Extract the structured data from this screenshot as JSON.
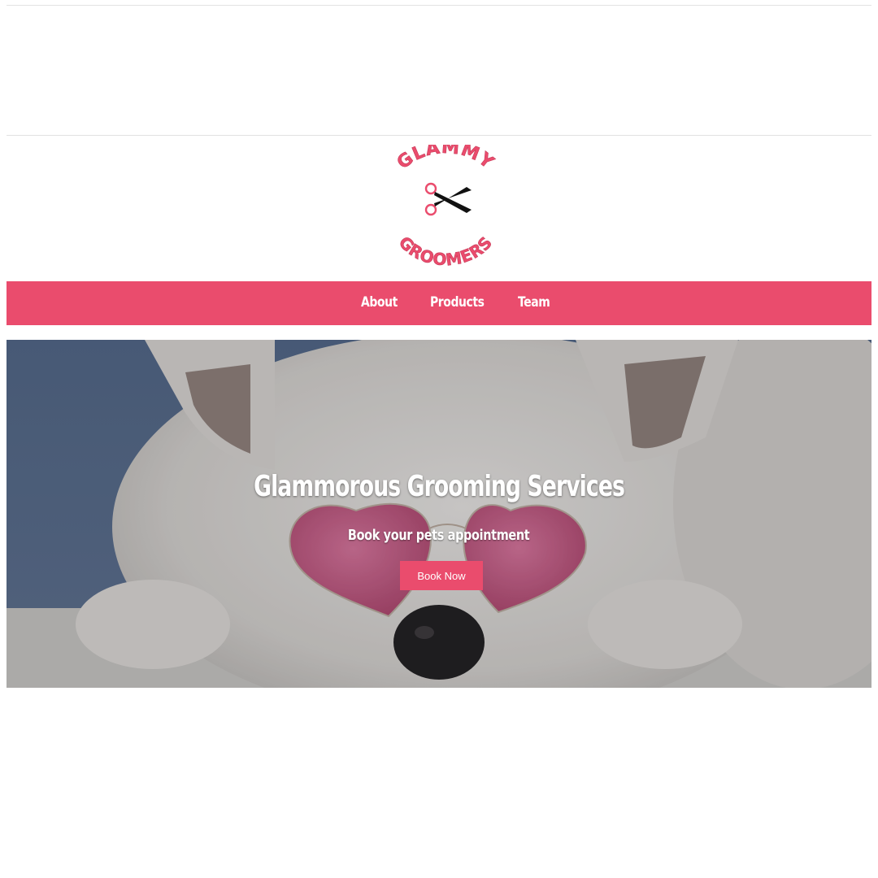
{
  "logo": {
    "top_text": "GLAMMY",
    "bottom_text": "GROOMERS",
    "icon": "scissors-icon",
    "color": "#ea4c6d"
  },
  "nav": {
    "items": [
      {
        "label": "About"
      },
      {
        "label": "Products"
      },
      {
        "label": "Team"
      }
    ],
    "background": "#ea4c6d"
  },
  "hero": {
    "title": "Glammorous Grooming Services",
    "subtitle": "Book your pets appointment",
    "button_label": "Book Now",
    "image": "white-dog-with-pink-heart-sunglasses"
  }
}
